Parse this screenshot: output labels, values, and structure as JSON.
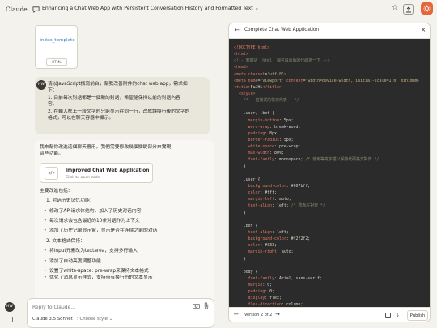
{
  "app": {
    "brand": "Claude",
    "conversation_title": "Enhancing a Chat Web App with Persistent Conversation History and Formatted Text",
    "user_initials": "HW"
  },
  "file": {
    "name": "index_template",
    "type": "HTML"
  },
  "user_message": {
    "lines": [
      "请以JavaScript撰寫前台，幫我改善附件的chat web app，需求如",
      "下：",
      "1. 目前每次對話都是一個新的對話，希望能保持以前的對話內容",
      "容。",
      "2. 在輸入框上一段文字时只能显示在同一行，改成讓換行後的文字的",
      "格式，可以在聊天容器中顯示。"
    ]
  },
  "assistant": {
    "intro": [
      "我來幫你改進這個聊天應用。我們需要修改幾個關鍵部分來實現",
      "這些功能。"
    ],
    "artifact": {
      "title": "Improved Chat Web Application",
      "subtitle": "Click to open code"
    },
    "main_changes": "主要改進包括：",
    "section1": "1. 对话历史记忆功能：",
    "bullets1": [
      "修改了API请求体结构，加入了历史对话内容",
      "每次请求会包含最近的10条对话作为上下文",
      "添加了历史记录显示窗，显示是否在连续之前的对话"
    ],
    "section2": "2. 文本格式保持：",
    "bullets2": [
      "将input元素改为textarea，支持多行输入",
      "添加了自动高度调整功能",
      "设置了white-space: pre-wrap来保持文本格式",
      "优化了消息显示样式，支持带有换行符的文本显示"
    ]
  },
  "composer": {
    "placeholder": "Reply to Claude...",
    "model": "Claude 3.5 Sonnet",
    "style": "Choose style"
  },
  "panel": {
    "title": "Complete Chat Web Application",
    "version": "Version 2 of 2",
    "publish_label": "Publish",
    "code_lines": [
      [
        [
          "tag",
          "<!DOCTYPE html>"
        ]
      ],
      [
        [
          "tag",
          "<html>"
        ]
      ],
      [
        [
          "com",
          "<!-- 繁體語  html  檔名與原版的代碼為一下 -->"
        ]
      ],
      [
        [
          "tag",
          "<head>"
        ]
      ],
      [
        [
          "tag",
          "<meta "
        ],
        [
          "key",
          "charset"
        ],
        [
          "txt",
          "="
        ],
        [
          "val",
          "\"utf-8\""
        ],
        [
          "tag",
          ">"
        ]
      ],
      [
        [
          "tag",
          "<meta "
        ],
        [
          "key",
          "name"
        ],
        [
          "txt",
          "="
        ],
        [
          "val",
          "\"viewport\""
        ],
        [
          "txt",
          " "
        ],
        [
          "key",
          "content"
        ],
        [
          "txt",
          "="
        ],
        [
          "val",
          "\"width=device-width, initial-scale=1.0, minimum-"
        ]
      ],
      [
        [
          "tag",
          "<title>"
        ],
        [
          "txt",
          "FuJHi"
        ],
        [
          "tag",
          "</title>"
        ]
      ],
      [
        [
          "tag",
          "  <style>"
        ]
      ],
      [
        [
          "com",
          "    /*   直接式的樣式代表   */"
        ]
      ],
      [
        [
          "txt",
          ""
        ]
      ],
      [
        [
          "txt",
          "    .user, .bot {"
        ]
      ],
      [
        [
          "key",
          "      margin-bottom"
        ],
        [
          "txt",
          ": 5px;"
        ]
      ],
      [
        [
          "key",
          "      word-wrap"
        ],
        [
          "txt",
          ": break-word;"
        ]
      ],
      [
        [
          "key",
          "      padding"
        ],
        [
          "txt",
          ": 8px;"
        ]
      ],
      [
        [
          "key",
          "      border-radius"
        ],
        [
          "txt",
          ": 5px;"
        ]
      ],
      [
        [
          "key",
          "      white-space"
        ],
        [
          "txt",
          ": pre-wrap;"
        ]
      ],
      [
        [
          "key",
          "      max-width"
        ],
        [
          "txt",
          ": 80%;"
        ]
      ],
      [
        [
          "key",
          "      font-family"
        ],
        [
          "txt",
          ": monospace; "
        ],
        [
          "com",
          "/* 使用等寬字體以保持代碼格式對齊 */"
        ]
      ],
      [
        [
          "txt",
          "    }"
        ]
      ],
      [
        [
          "txt",
          ""
        ]
      ],
      [
        [
          "txt",
          "    .user {"
        ]
      ],
      [
        [
          "key",
          "      background-color"
        ],
        [
          "txt",
          ": #007bff;"
        ]
      ],
      [
        [
          "key",
          "      color"
        ],
        [
          "txt",
          ": #fff;"
        ]
      ],
      [
        [
          "key",
          "      margin-left"
        ],
        [
          "txt",
          ": auto;"
        ]
      ],
      [
        [
          "key",
          "      text-align"
        ],
        [
          "txt",
          ": left; "
        ],
        [
          "com",
          "/* 改為左對齊 */"
        ]
      ],
      [
        [
          "txt",
          "    }"
        ]
      ],
      [
        [
          "txt",
          ""
        ]
      ],
      [
        [
          "txt",
          "    .bot {"
        ]
      ],
      [
        [
          "key",
          "      text-align"
        ],
        [
          "txt",
          ": left;"
        ]
      ],
      [
        [
          "key",
          "      background-color"
        ],
        [
          "txt",
          ": #f2f2f2;"
        ]
      ],
      [
        [
          "key",
          "      color"
        ],
        [
          "txt",
          ": #333;"
        ]
      ],
      [
        [
          "key",
          "      margin-right"
        ],
        [
          "txt",
          ": auto;"
        ]
      ],
      [
        [
          "txt",
          "    }"
        ]
      ],
      [
        [
          "txt",
          ""
        ]
      ],
      [
        [
          "txt",
          "    body {"
        ]
      ],
      [
        [
          "key",
          "      font-family"
        ],
        [
          "txt",
          ": Arial, sans-serif;"
        ]
      ],
      [
        [
          "key",
          "      margin"
        ],
        [
          "txt",
          ": 0;"
        ]
      ],
      [
        [
          "key",
          "      padding"
        ],
        [
          "txt",
          ": 0;"
        ]
      ],
      [
        [
          "key",
          "      display"
        ],
        [
          "txt",
          ": flex;"
        ]
      ],
      [
        [
          "key",
          "      flex-direction"
        ],
        [
          "txt",
          ": column;"
        ]
      ]
    ]
  },
  "colors": {
    "accent": "#e4663a",
    "code_bg": "#2b2b2b",
    "tag": "#e07a5f",
    "comment": "#7d8a6a"
  }
}
